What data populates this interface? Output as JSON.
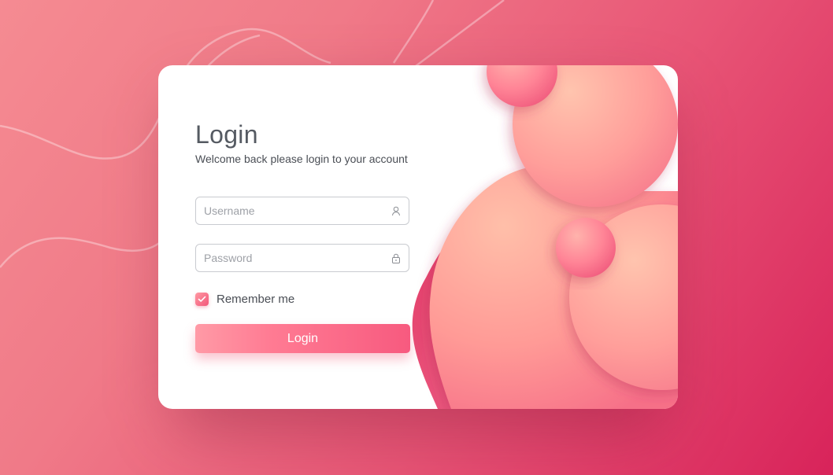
{
  "login": {
    "title": "Login",
    "subtitle": "Welcome back please login to your account",
    "username_placeholder": "Username",
    "password_placeholder": "Password",
    "remember_label": "Remember me",
    "remember_checked": true,
    "button_label": "Login"
  },
  "icons": {
    "username": "user-icon",
    "password": "lock-icon",
    "checkbox": "check-icon"
  },
  "colors": {
    "accent": "#f75a7f",
    "accent_light": "#ff9aa6",
    "background_start": "#f58b92",
    "background_end": "#d8235a"
  }
}
